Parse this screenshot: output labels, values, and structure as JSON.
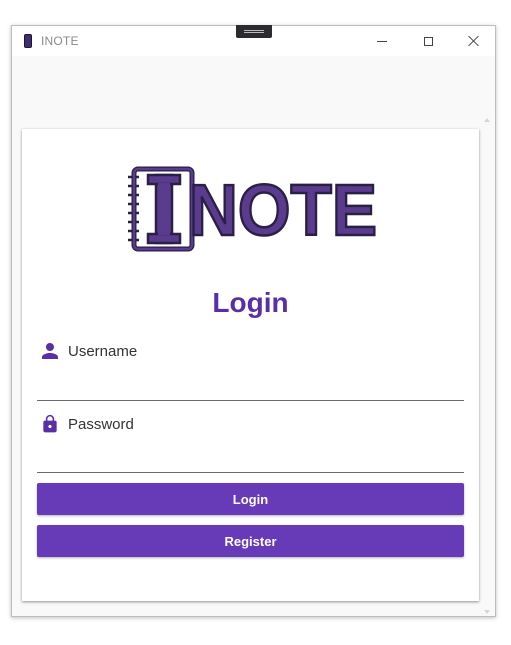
{
  "window": {
    "title": "INOTE"
  },
  "logo": {
    "text": "INOTE",
    "color": "#5a3b8e",
    "outline": "#2a1f45"
  },
  "form": {
    "title": "Login",
    "username_label": "Username",
    "username_value": "",
    "password_label": "Password",
    "password_value": "",
    "login_button": "Login",
    "register_button": "Register"
  },
  "icons": {
    "username": "person-icon",
    "password": "lock-icon",
    "app": "notebook-icon"
  },
  "colors": {
    "accent": "#673ab7",
    "title": "#5a2ea6"
  }
}
